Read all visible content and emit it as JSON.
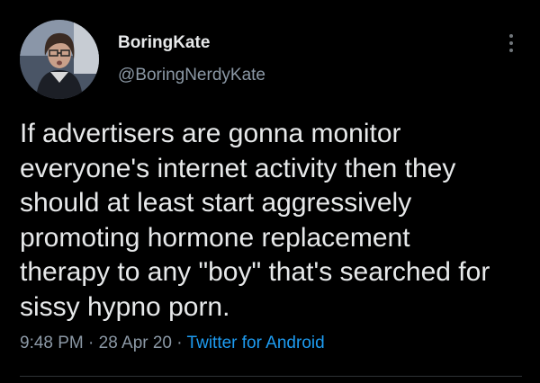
{
  "author": {
    "display_name": "BoringKate",
    "handle": "@BoringNerdyKate"
  },
  "tweet": {
    "text": "If advertisers are gonna monitor\neveryone's internet activity then they\nshould at least start aggressively\npromoting hormone replacement\ntherapy to any \"boy\" that's searched for\nsissy hypno porn.",
    "time": "9:48 PM",
    "date": "28 Apr 20",
    "source": "Twitter for Android",
    "separator": "·"
  },
  "icons": {
    "more": "more-vertical-icon"
  },
  "colors": {
    "background": "#000000",
    "text": "#e7e9ea",
    "secondary_text": "#8b98a5",
    "link": "#1d9bf0",
    "divider": "#2f3336"
  }
}
